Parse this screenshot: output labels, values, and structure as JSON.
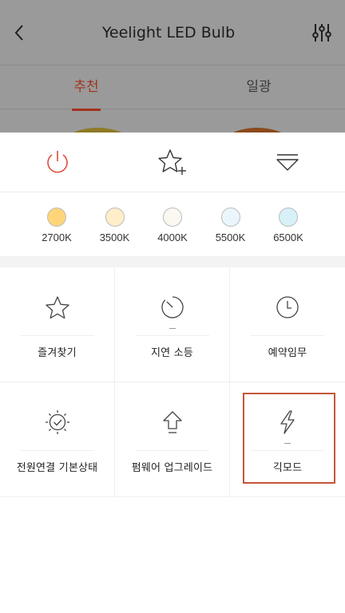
{
  "background": {
    "title": "Yeelight LED Bulb",
    "tabs": [
      {
        "label": "추천",
        "active": true
      },
      {
        "label": "일광",
        "active": false
      }
    ]
  },
  "quick_actions": [
    {
      "name": "power",
      "icon": "power-icon"
    },
    {
      "name": "favorite-add",
      "icon": "star-plus-icon"
    },
    {
      "name": "collapse",
      "icon": "chevron-down-icon"
    }
  ],
  "color_presets": [
    {
      "label": "2700K",
      "color": "#ffd57a"
    },
    {
      "label": "3500K",
      "color": "#ffeec8"
    },
    {
      "label": "4000K",
      "color": "#fbf8f2"
    },
    {
      "label": "5500K",
      "color": "#eaf6fb"
    },
    {
      "label": "6500K",
      "color": "#d8f1f8"
    }
  ],
  "functions": [
    {
      "label": "즐겨찾기",
      "icon": "star-icon"
    },
    {
      "label": "지연 소등",
      "icon": "timer-icon"
    },
    {
      "label": "예약임무",
      "icon": "clock-icon"
    },
    {
      "label": "전원연결 기본상태",
      "icon": "sun-check-icon"
    },
    {
      "label": "펌웨어 업그레이드",
      "icon": "upgrade-arrow-icon"
    },
    {
      "label": "긱모드",
      "icon": "lightning-icon"
    }
  ],
  "colors": {
    "accent": "#c4553b",
    "power_red": "#e04a3a"
  }
}
